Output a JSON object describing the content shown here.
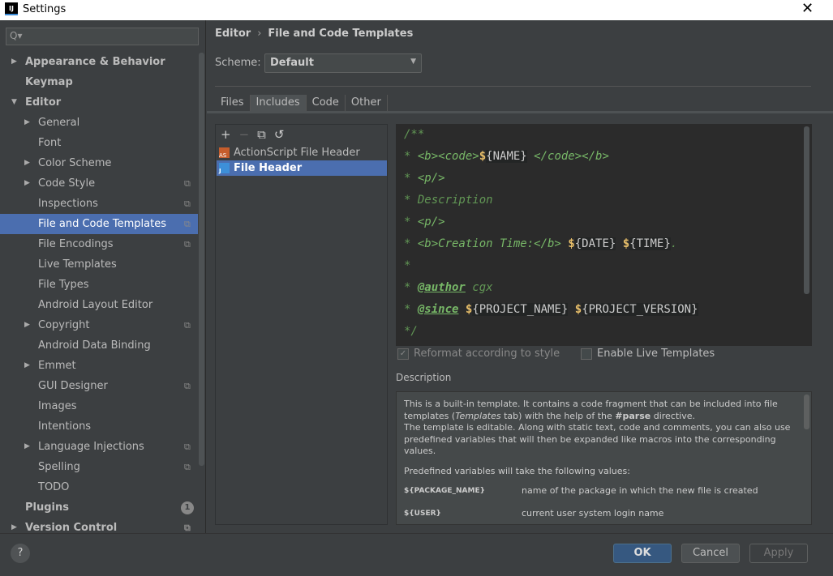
{
  "window": {
    "title": "Settings",
    "logo": "IJ"
  },
  "sidebar": {
    "search_placeholder": "Q▾",
    "items": [
      {
        "label": "Appearance & Behavior",
        "bold": true,
        "arrow": "right",
        "level": 0
      },
      {
        "label": "Keymap",
        "bold": true,
        "level": 0
      },
      {
        "label": "Editor",
        "bold": true,
        "arrow": "down",
        "level": 0
      },
      {
        "label": "General",
        "arrow": "right",
        "level": 1
      },
      {
        "label": "Font",
        "level": 1
      },
      {
        "label": "Color Scheme",
        "arrow": "right",
        "level": 1
      },
      {
        "label": "Code Style",
        "arrow": "right",
        "level": 1,
        "copy": true
      },
      {
        "label": "Inspections",
        "level": 1,
        "copy": true
      },
      {
        "label": "File and Code Templates",
        "level": 1,
        "copy": true,
        "selected": true
      },
      {
        "label": "File Encodings",
        "level": 1,
        "copy": true
      },
      {
        "label": "Live Templates",
        "level": 1
      },
      {
        "label": "File Types",
        "level": 1
      },
      {
        "label": "Android Layout Editor",
        "level": 1
      },
      {
        "label": "Copyright",
        "arrow": "right",
        "level": 1,
        "copy": true
      },
      {
        "label": "Android Data Binding",
        "level": 1
      },
      {
        "label": "Emmet",
        "arrow": "right",
        "level": 1
      },
      {
        "label": "GUI Designer",
        "level": 1,
        "copy": true
      },
      {
        "label": "Images",
        "level": 1
      },
      {
        "label": "Intentions",
        "level": 1
      },
      {
        "label": "Language Injections",
        "arrow": "right",
        "level": 1,
        "copy": true
      },
      {
        "label": "Spelling",
        "level": 1,
        "copy": true
      },
      {
        "label": "TODO",
        "level": 1
      },
      {
        "label": "Plugins",
        "bold": true,
        "level": 0,
        "badge": "1"
      },
      {
        "label": "Version Control",
        "bold": true,
        "arrow": "right",
        "level": 0,
        "copy": true
      }
    ]
  },
  "breadcrumb": {
    "parent": "Editor",
    "sep": "›",
    "current": "File and Code Templates"
  },
  "scheme": {
    "label": "Scheme:",
    "value": "Default"
  },
  "tabs": [
    {
      "label": "Files"
    },
    {
      "label": "Includes",
      "active": true
    },
    {
      "label": "Code"
    },
    {
      "label": "Other"
    }
  ],
  "toolbar": {
    "add": "+",
    "remove": "−",
    "copy": "⧉",
    "reset": "↺"
  },
  "templates": [
    {
      "label": "ActionScript File Header",
      "icon": "AS"
    },
    {
      "label": "File Header",
      "icon": "J",
      "selected": true
    }
  ],
  "editor_lines": [
    [
      [
        "c",
        "/**"
      ]
    ],
    [
      [
        "c",
        "* "
      ],
      [
        "g",
        "<b><code>"
      ],
      [
        "d",
        "$"
      ],
      [
        "v",
        "{NAME}"
      ],
      [
        "g",
        " </code></b>"
      ]
    ],
    [
      [
        "c",
        "* "
      ],
      [
        "g",
        "<p/>"
      ]
    ],
    [
      [
        "c",
        "* Description"
      ]
    ],
    [
      [
        "c",
        "* "
      ],
      [
        "g",
        "<p/>"
      ]
    ],
    [
      [
        "c",
        "* "
      ],
      [
        "g",
        "<b>Creation Time:</b> "
      ],
      [
        "d",
        "$"
      ],
      [
        "v",
        "{DATE}"
      ],
      [
        "c",
        " "
      ],
      [
        "d",
        "$"
      ],
      [
        "v",
        "{TIME}"
      ],
      [
        "c",
        "."
      ]
    ],
    [
      [
        "c",
        "*"
      ]
    ],
    [
      [
        "c",
        "* "
      ],
      [
        "t",
        "@author"
      ],
      [
        "c",
        " cgx"
      ]
    ],
    [
      [
        "c",
        "* "
      ],
      [
        "t",
        "@since"
      ],
      [
        "c",
        " "
      ],
      [
        "d",
        "$"
      ],
      [
        "v",
        "{PROJECT_NAME}"
      ],
      [
        "c",
        " "
      ],
      [
        "d",
        "$"
      ],
      [
        "v",
        "{PROJECT_VERSION}"
      ]
    ],
    [
      [
        "c",
        "*/"
      ]
    ]
  ],
  "options": {
    "reformat": {
      "label": "Reformat according to style",
      "checked": true,
      "disabled": true
    },
    "live": {
      "label": "Enable Live Templates",
      "checked": false
    }
  },
  "description": {
    "label": "Description",
    "p1a": "This is a built-in template. It contains a code fragment that can be included into file templates (",
    "p1i": "Templates",
    "p1b": " tab) with the help of the ",
    "p1k": "#parse",
    "p1c": " directive.",
    "p2": "The template is editable. Along with static text, code and comments, you can also use predefined variables that will then be expanded like macros into the corresponding values.",
    "p3": "Predefined variables will take the following values:",
    "vars": [
      {
        "name": "${PACKAGE_NAME}",
        "desc": "name of the package in which the new file is created"
      },
      {
        "name": "${USER}",
        "desc": "current user system login name"
      }
    ]
  },
  "buttons": {
    "help": "?",
    "ok": "OK",
    "cancel": "Cancel",
    "apply": "Apply"
  }
}
